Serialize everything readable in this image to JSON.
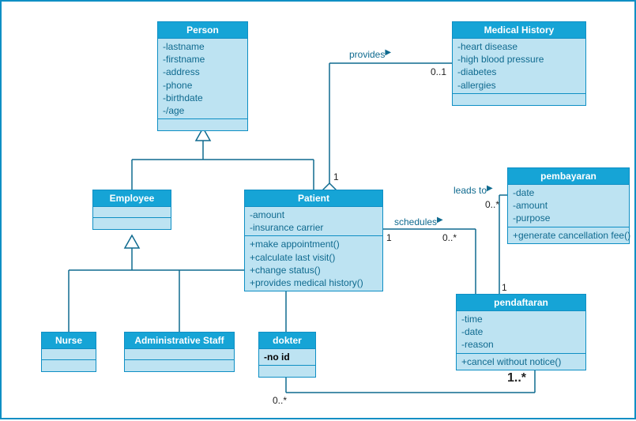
{
  "classes": {
    "person": {
      "name": "Person",
      "attrs": [
        "-lastname",
        "-firstname",
        "-address",
        "-phone",
        "-birthdate",
        "-/age"
      ]
    },
    "medicalHistory": {
      "name": "Medical History",
      "attrs": [
        "-heart disease",
        "-high blood pressure",
        "-diabetes",
        "-allergies"
      ]
    },
    "employee": {
      "name": "Employee"
    },
    "patient": {
      "name": "Patient",
      "attrs": [
        "-amount",
        "-insurance carrier"
      ],
      "ops": [
        "+make appointment()",
        "+calculate last visit()",
        "+change status()",
        "+provides medical history()"
      ]
    },
    "pembayaran": {
      "name": "pembayaran",
      "attrs": [
        "-date",
        "-amount",
        "-purpose"
      ],
      "ops": [
        "+generate cancellation fee()"
      ]
    },
    "pendaftaran": {
      "name": "pendaftaran",
      "attrs": [
        "-time",
        "-date",
        "-reason"
      ],
      "ops": [
        "+cancel without notice()"
      ]
    },
    "nurse": {
      "name": "Nurse"
    },
    "adminStaff": {
      "name": "Administrative Staff"
    },
    "dokter": {
      "name": "dokter",
      "attrs": [
        "-no id"
      ]
    }
  },
  "relations": {
    "provides": {
      "label": "provides",
      "mult_end": "0..1",
      "mult_start": "1"
    },
    "schedules": {
      "label": "schedules",
      "mult_start": "1",
      "mult_end": "0..*"
    },
    "leadsTo": {
      "label": "leads to",
      "mult_start": "1",
      "mult_end": "0..*"
    },
    "dokterPendaftaran": {
      "mult_start": "0..*",
      "mult_end": "1..*"
    }
  }
}
